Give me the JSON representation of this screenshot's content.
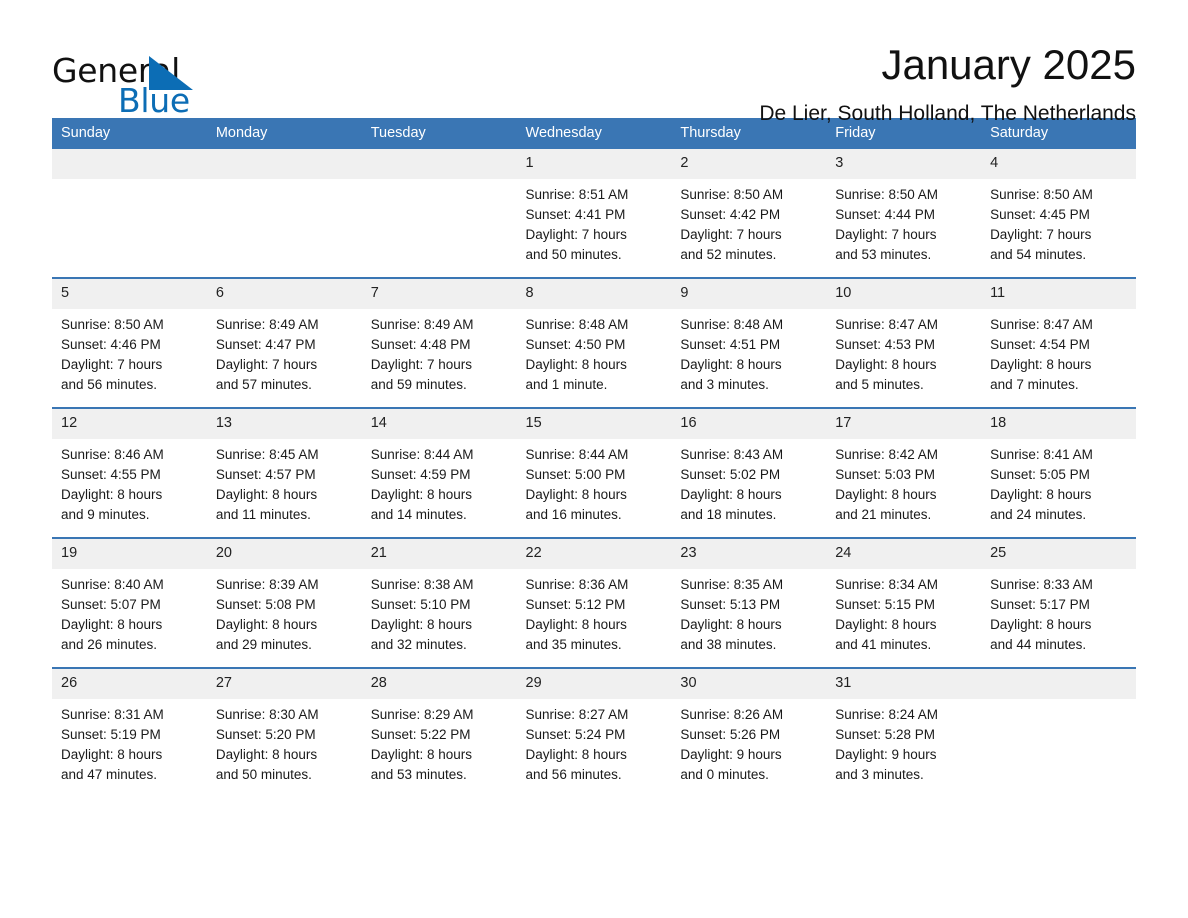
{
  "logo": {
    "line1": "General",
    "line2": "Blue",
    "triangle_color": "#0c6db5",
    "text_color": "#111111"
  },
  "header": {
    "title": "January 2025",
    "subtitle": "De Lier, South Holland, The Netherlands"
  },
  "theme": {
    "header_blue": "#3a76b4",
    "daynum_band": "#f0f0f0",
    "text": "#1a1a1a"
  },
  "calendar": {
    "weekday_headers": [
      "Sunday",
      "Monday",
      "Tuesday",
      "Wednesday",
      "Thursday",
      "Friday",
      "Saturday"
    ],
    "weeks": [
      [
        {
          "day": "",
          "lines": []
        },
        {
          "day": "",
          "lines": []
        },
        {
          "day": "",
          "lines": []
        },
        {
          "day": "1",
          "lines": [
            "Sunrise: 8:51 AM",
            "Sunset: 4:41 PM",
            "Daylight: 7 hours",
            "and 50 minutes."
          ]
        },
        {
          "day": "2",
          "lines": [
            "Sunrise: 8:50 AM",
            "Sunset: 4:42 PM",
            "Daylight: 7 hours",
            "and 52 minutes."
          ]
        },
        {
          "day": "3",
          "lines": [
            "Sunrise: 8:50 AM",
            "Sunset: 4:44 PM",
            "Daylight: 7 hours",
            "and 53 minutes."
          ]
        },
        {
          "day": "4",
          "lines": [
            "Sunrise: 8:50 AM",
            "Sunset: 4:45 PM",
            "Daylight: 7 hours",
            "and 54 minutes."
          ]
        }
      ],
      [
        {
          "day": "5",
          "lines": [
            "Sunrise: 8:50 AM",
            "Sunset: 4:46 PM",
            "Daylight: 7 hours",
            "and 56 minutes."
          ]
        },
        {
          "day": "6",
          "lines": [
            "Sunrise: 8:49 AM",
            "Sunset: 4:47 PM",
            "Daylight: 7 hours",
            "and 57 minutes."
          ]
        },
        {
          "day": "7",
          "lines": [
            "Sunrise: 8:49 AM",
            "Sunset: 4:48 PM",
            "Daylight: 7 hours",
            "and 59 minutes."
          ]
        },
        {
          "day": "8",
          "lines": [
            "Sunrise: 8:48 AM",
            "Sunset: 4:50 PM",
            "Daylight: 8 hours",
            "and 1 minute."
          ]
        },
        {
          "day": "9",
          "lines": [
            "Sunrise: 8:48 AM",
            "Sunset: 4:51 PM",
            "Daylight: 8 hours",
            "and 3 minutes."
          ]
        },
        {
          "day": "10",
          "lines": [
            "Sunrise: 8:47 AM",
            "Sunset: 4:53 PM",
            "Daylight: 8 hours",
            "and 5 minutes."
          ]
        },
        {
          "day": "11",
          "lines": [
            "Sunrise: 8:47 AM",
            "Sunset: 4:54 PM",
            "Daylight: 8 hours",
            "and 7 minutes."
          ]
        }
      ],
      [
        {
          "day": "12",
          "lines": [
            "Sunrise: 8:46 AM",
            "Sunset: 4:55 PM",
            "Daylight: 8 hours",
            "and 9 minutes."
          ]
        },
        {
          "day": "13",
          "lines": [
            "Sunrise: 8:45 AM",
            "Sunset: 4:57 PM",
            "Daylight: 8 hours",
            "and 11 minutes."
          ]
        },
        {
          "day": "14",
          "lines": [
            "Sunrise: 8:44 AM",
            "Sunset: 4:59 PM",
            "Daylight: 8 hours",
            "and 14 minutes."
          ]
        },
        {
          "day": "15",
          "lines": [
            "Sunrise: 8:44 AM",
            "Sunset: 5:00 PM",
            "Daylight: 8 hours",
            "and 16 minutes."
          ]
        },
        {
          "day": "16",
          "lines": [
            "Sunrise: 8:43 AM",
            "Sunset: 5:02 PM",
            "Daylight: 8 hours",
            "and 18 minutes."
          ]
        },
        {
          "day": "17",
          "lines": [
            "Sunrise: 8:42 AM",
            "Sunset: 5:03 PM",
            "Daylight: 8 hours",
            "and 21 minutes."
          ]
        },
        {
          "day": "18",
          "lines": [
            "Sunrise: 8:41 AM",
            "Sunset: 5:05 PM",
            "Daylight: 8 hours",
            "and 24 minutes."
          ]
        }
      ],
      [
        {
          "day": "19",
          "lines": [
            "Sunrise: 8:40 AM",
            "Sunset: 5:07 PM",
            "Daylight: 8 hours",
            "and 26 minutes."
          ]
        },
        {
          "day": "20",
          "lines": [
            "Sunrise: 8:39 AM",
            "Sunset: 5:08 PM",
            "Daylight: 8 hours",
            "and 29 minutes."
          ]
        },
        {
          "day": "21",
          "lines": [
            "Sunrise: 8:38 AM",
            "Sunset: 5:10 PM",
            "Daylight: 8 hours",
            "and 32 minutes."
          ]
        },
        {
          "day": "22",
          "lines": [
            "Sunrise: 8:36 AM",
            "Sunset: 5:12 PM",
            "Daylight: 8 hours",
            "and 35 minutes."
          ]
        },
        {
          "day": "23",
          "lines": [
            "Sunrise: 8:35 AM",
            "Sunset: 5:13 PM",
            "Daylight: 8 hours",
            "and 38 minutes."
          ]
        },
        {
          "day": "24",
          "lines": [
            "Sunrise: 8:34 AM",
            "Sunset: 5:15 PM",
            "Daylight: 8 hours",
            "and 41 minutes."
          ]
        },
        {
          "day": "25",
          "lines": [
            "Sunrise: 8:33 AM",
            "Sunset: 5:17 PM",
            "Daylight: 8 hours",
            "and 44 minutes."
          ]
        }
      ],
      [
        {
          "day": "26",
          "lines": [
            "Sunrise: 8:31 AM",
            "Sunset: 5:19 PM",
            "Daylight: 8 hours",
            "and 47 minutes."
          ]
        },
        {
          "day": "27",
          "lines": [
            "Sunrise: 8:30 AM",
            "Sunset: 5:20 PM",
            "Daylight: 8 hours",
            "and 50 minutes."
          ]
        },
        {
          "day": "28",
          "lines": [
            "Sunrise: 8:29 AM",
            "Sunset: 5:22 PM",
            "Daylight: 8 hours",
            "and 53 minutes."
          ]
        },
        {
          "day": "29",
          "lines": [
            "Sunrise: 8:27 AM",
            "Sunset: 5:24 PM",
            "Daylight: 8 hours",
            "and 56 minutes."
          ]
        },
        {
          "day": "30",
          "lines": [
            "Sunrise: 8:26 AM",
            "Sunset: 5:26 PM",
            "Daylight: 9 hours",
            "and 0 minutes."
          ]
        },
        {
          "day": "31",
          "lines": [
            "Sunrise: 8:24 AM",
            "Sunset: 5:28 PM",
            "Daylight: 9 hours",
            "and 3 minutes."
          ]
        },
        {
          "day": "",
          "lines": []
        }
      ]
    ]
  }
}
